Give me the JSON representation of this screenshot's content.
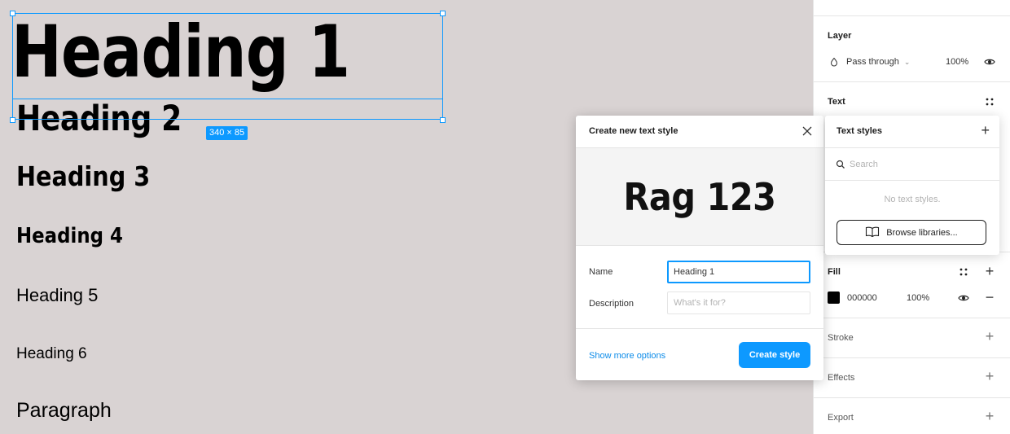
{
  "canvas": {
    "h1": "Heading 1",
    "h2": "Heading 2",
    "h3": "Heading 3",
    "h4": "Heading 4",
    "h5": "Heading 5",
    "h6": "Heading 6",
    "paragraph": "Paragraph",
    "selection_dimensions": "340 × 85"
  },
  "dialog": {
    "title": "Create new text style",
    "preview_text": "Rag 123",
    "name_label": "Name",
    "name_value": "Heading 1",
    "description_label": "Description",
    "description_placeholder": "What's it for?",
    "show_more": "Show more options",
    "create_button": "Create style",
    "close_icon": "close-icon"
  },
  "text_styles_popover": {
    "title": "Text styles",
    "search_placeholder": "Search",
    "empty_text": "No text styles.",
    "browse_button": "Browse libraries..."
  },
  "panel": {
    "layer": {
      "title": "Layer",
      "blend_mode": "Pass through",
      "opacity": "100%"
    },
    "text": {
      "title": "Text"
    },
    "fill": {
      "title": "Fill",
      "color_hex": "000000",
      "opacity": "100%",
      "swatch_color": "#000000"
    },
    "stroke": {
      "title": "Stroke"
    },
    "effects": {
      "title": "Effects"
    },
    "export": {
      "title": "Export"
    }
  },
  "colors": {
    "accent": "#0d99ff",
    "canvas_bg": "#d9d3d3"
  }
}
